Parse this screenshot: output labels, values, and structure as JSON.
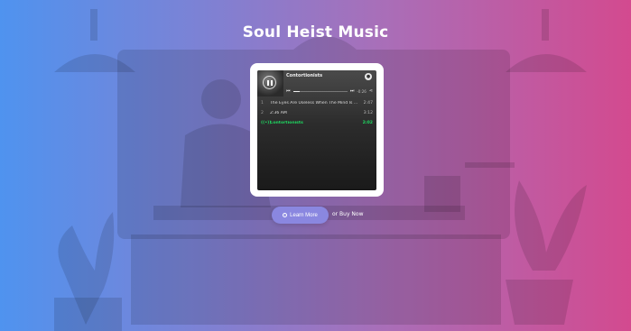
{
  "page": {
    "title": "Soul Heist Music"
  },
  "player": {
    "track_title": "Contortionists",
    "time_readout": "-0:26",
    "tracks": [
      {
        "num": "1",
        "name": "The Eyes Are Useless When The Mind Is ...",
        "dur": "2:47"
      },
      {
        "num": "2",
        "name": "2:36 AM",
        "dur": "3:12"
      },
      {
        "num": "((•))",
        "name": "Contortionists",
        "dur": "2:02"
      }
    ]
  },
  "actions": {
    "learn_more": "Learn More",
    "buy_now": "or Buy Now"
  },
  "colors": {
    "gradient_left": "#4f93ef",
    "gradient_right": "#d34a8f",
    "active_track": "#1ed760",
    "button": "#8a87e0"
  },
  "icons": {
    "pause": "pause-icon",
    "spotify": "spotify-icon",
    "skip_back": "skip-back-icon",
    "skip_forward": "skip-forward-icon",
    "share": "share-icon",
    "learn_more": "circle-arrow-icon"
  }
}
